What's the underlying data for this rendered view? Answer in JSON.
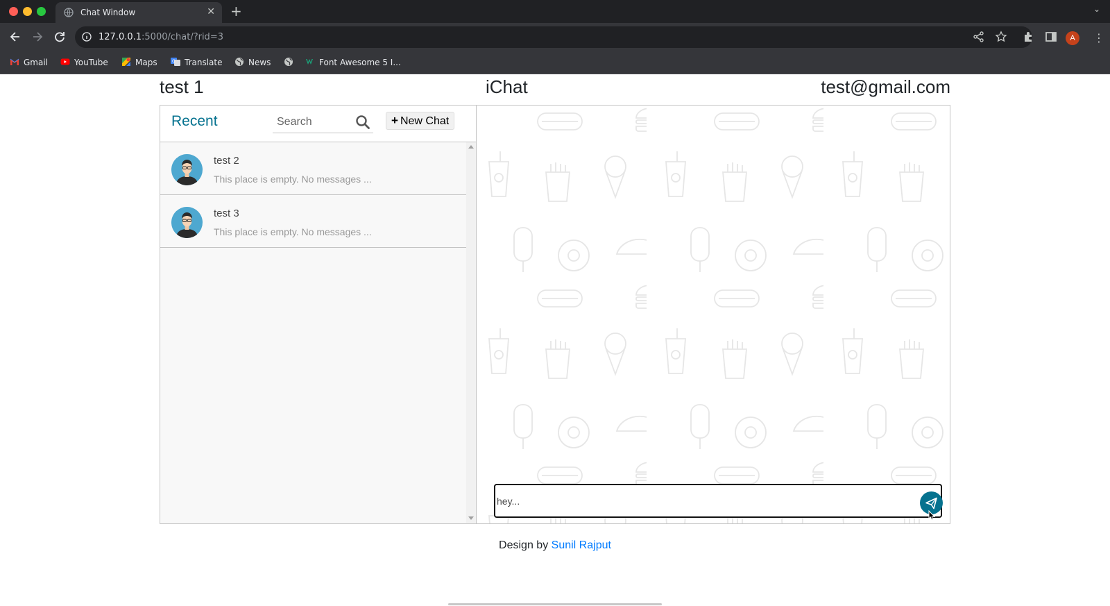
{
  "browser": {
    "tab_title": "Chat Window",
    "url_host": "127.0.0.1",
    "url_path": ":5000/chat/?rid=3",
    "profile_initial": "A",
    "bookmarks": [
      {
        "label": "Gmail",
        "icon": "gmail-icon"
      },
      {
        "label": "YouTube",
        "icon": "youtube-icon"
      },
      {
        "label": "Maps",
        "icon": "maps-icon"
      },
      {
        "label": "Translate",
        "icon": "translate-icon"
      },
      {
        "label": "News",
        "icon": "globe-icon"
      },
      {
        "label": "",
        "icon": "globe-icon"
      },
      {
        "label": "Font Awesome 5 I...",
        "icon": "font-awesome-icon"
      }
    ]
  },
  "header": {
    "username": "test 1",
    "brand": "iChat",
    "email": "test@gmail.com"
  },
  "sidebar": {
    "title": "Recent",
    "search_placeholder": "Search",
    "new_chat_label": "New Chat",
    "chats": [
      {
        "name": "test 2",
        "preview": "This place is empty. No messages ..."
      },
      {
        "name": "test 3",
        "preview": "This place is empty. No messages ..."
      }
    ]
  },
  "composer": {
    "value": "hey...",
    "icon": "paper-plane-icon"
  },
  "footer": {
    "prefix": "Design by",
    "author": "Sunil Rajput"
  },
  "colors": {
    "accent": "#05728f",
    "link": "#007bff",
    "chrome_dark": "#202124",
    "chrome_mid": "#35363a"
  }
}
